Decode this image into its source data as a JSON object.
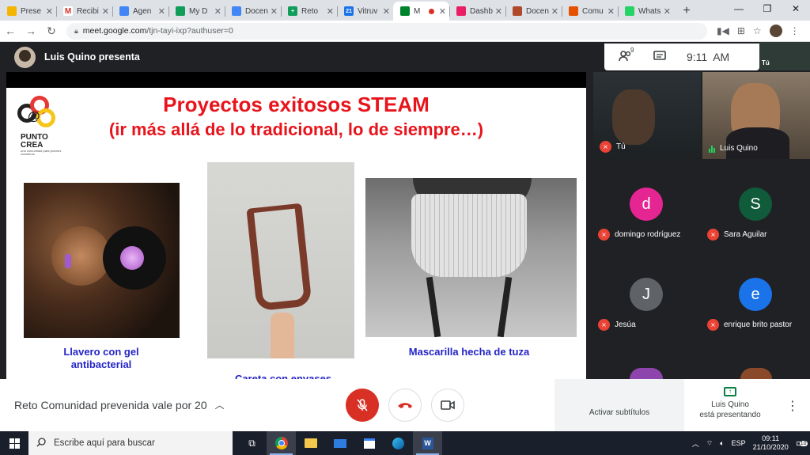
{
  "browser": {
    "tabs": [
      {
        "label": "Prese",
        "color": "#f4b400",
        "glyph": ""
      },
      {
        "label": "Recibi",
        "color": "#ffffff",
        "glyph": "M"
      },
      {
        "label": "Agen",
        "color": "#4285f4",
        "glyph": ""
      },
      {
        "label": "My D",
        "color": "#0f9d58",
        "glyph": ""
      },
      {
        "label": "Docen",
        "color": "#4285f4",
        "glyph": ""
      },
      {
        "label": "Reto",
        "color": "#0f9d58",
        "glyph": "+"
      },
      {
        "label": "Vitruv",
        "color": "#1a73e8",
        "glyph": "21"
      },
      {
        "label": "M",
        "color": "#00832d",
        "glyph": ""
      },
      {
        "label": "Dashb",
        "color": "#e91e63",
        "glyph": ""
      },
      {
        "label": "Docen",
        "color": "#b04a2a",
        "glyph": ""
      },
      {
        "label": "Comu",
        "color": "#e65100",
        "glyph": ""
      },
      {
        "label": "Whats",
        "color": "#25d366",
        "glyph": ""
      }
    ],
    "url_host": "meet.google.com",
    "url_path": "/tjn-tayi-ixp?authuser=0"
  },
  "meet": {
    "presenter_label": "Luis Quino presenta",
    "participant_count": "9",
    "time": "9:11  AM",
    "self_label": "Tú",
    "slide": {
      "title": "Proyectos exitosos STEAM",
      "subtitle": "(ir más allá de lo tradicional, lo de siempre…)",
      "logo_word1": "PUNTO",
      "logo_word2": "CREA",
      "logo_tagline": "una comunidad para jóvenes creadores",
      "captions": [
        "Llavero con gel antibacterial",
        "Careta con envases",
        "Mascarilla hecha de tuza"
      ]
    },
    "video_tiles": [
      {
        "name": "Tú",
        "muted": true
      },
      {
        "name": "Luis Quino",
        "muted": false
      }
    ],
    "participants": [
      {
        "initial": "d",
        "name": "domingo rodríguez",
        "color": "#e52592"
      },
      {
        "initial": "S",
        "name": "Sara Aguilar",
        "color": "#0f5b3a"
      },
      {
        "initial": "J",
        "name": "Jesúa",
        "color": "#5f6368"
      },
      {
        "initial": "e",
        "name": "enrique brito pastor",
        "color": "#1a73e8"
      }
    ],
    "meeting_name": "Reto Comunidad prevenida vale por 20",
    "captions_label": "Activar subtítulos",
    "presenting_line1": "Luis Quino",
    "presenting_line2": "está presentando"
  },
  "taskbar": {
    "search_placeholder": "Escribe aquí para buscar",
    "lang": "ESP",
    "clock_time": "09:11",
    "clock_date": "21/10/2020",
    "notif_count": "10"
  }
}
